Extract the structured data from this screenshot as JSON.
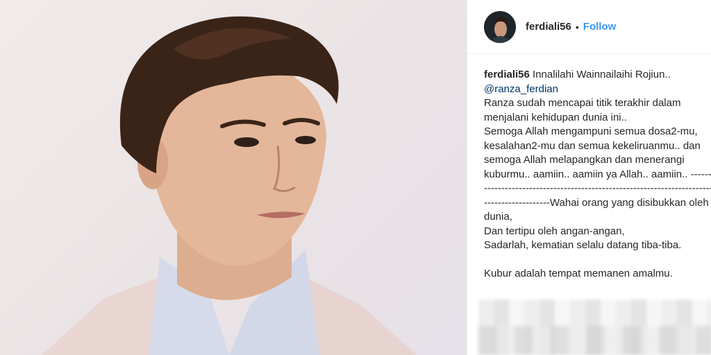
{
  "post": {
    "username": "ferdiali56",
    "separator": "•",
    "follow_label": "Follow",
    "caption": {
      "username": "ferdiali56",
      "line1": " Innalilahi Wainnailaihi Rojiun..",
      "mention": "@ranza_ferdian",
      "body": "Ranza sudah mencapai titik terakhir dalam menjalani kehidupan dunia ini..\nSemoga Allah mengampuni semua dosa2-mu, kesalahan2-mu dan semua kekeliruanmu.. dan semoga Allah melapangkan dan menerangi kuburmu.. aamiin.. aamiin ya Allah.. aamiin.. -------------------------------------------------------------------------------------------Wahai orang yang disibukkan oleh dunia,\nDan tertipu oleh angan-angan,\nSadarlah, kematian selalu datang tiba-tiba.\n\nKubur adalah tempat memanen amalmu."
    }
  }
}
